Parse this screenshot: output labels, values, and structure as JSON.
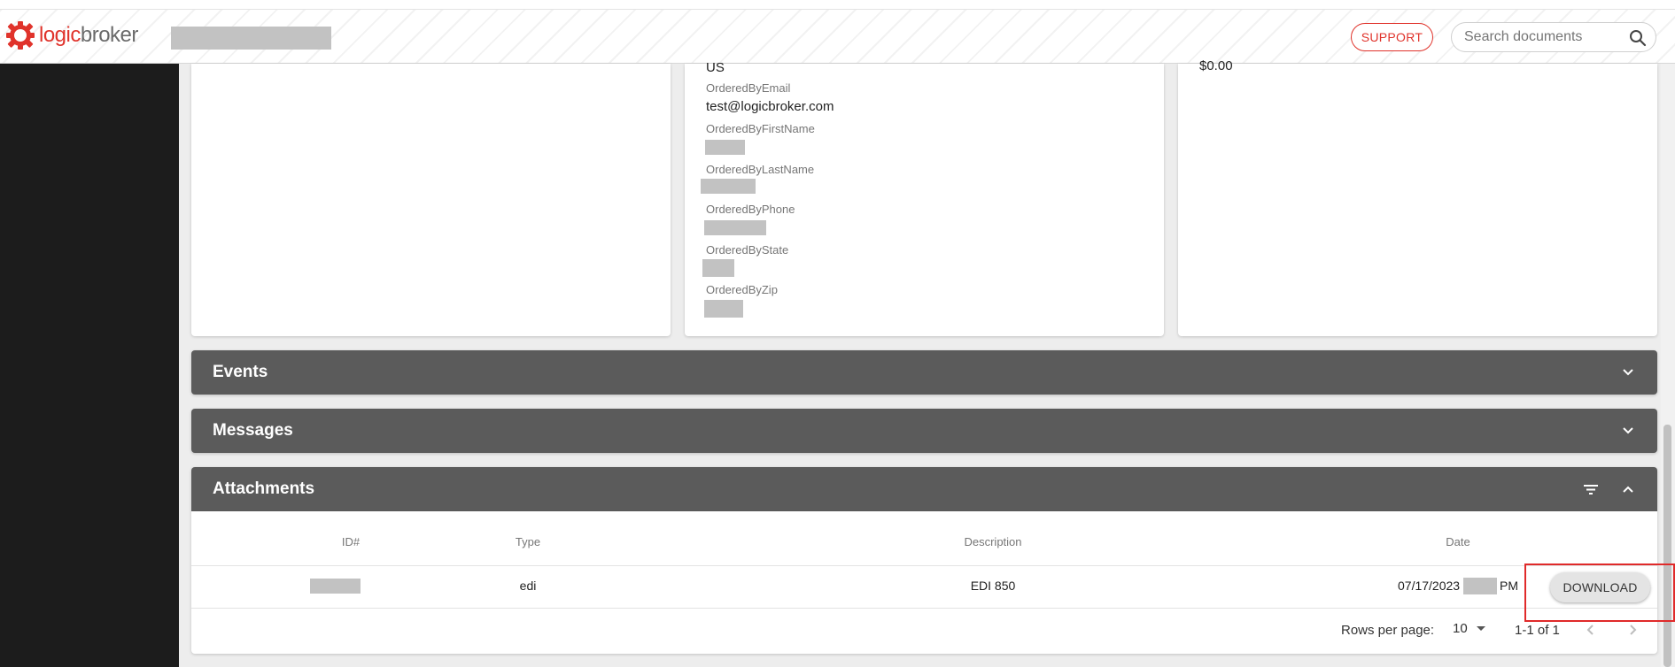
{
  "header": {
    "logo_part1": "logic",
    "logo_part2": "broker",
    "support_label": "SUPPORT",
    "search_placeholder": "Search documents"
  },
  "card_b": {
    "country": "US",
    "ordered_by_email_label": "OrderedByEmail",
    "ordered_by_email_value": "test@logicbroker.com",
    "ordered_by_first_name_label": "OrderedByFirstName",
    "ordered_by_last_name_label": "OrderedByLastName",
    "ordered_by_phone_label": "OrderedByPhone",
    "ordered_by_state_label": "OrderedByState",
    "ordered_by_zip_label": "OrderedByZip"
  },
  "card_c": {
    "amount": "$0.00"
  },
  "events": {
    "title": "Events"
  },
  "messages": {
    "title": "Messages"
  },
  "attachments": {
    "title": "Attachments",
    "columns": [
      "ID#",
      "Type",
      "Description",
      "Date"
    ],
    "rows": [
      {
        "type": "edi",
        "description": "EDI 850",
        "date": "07/17/2023",
        "time_suffix": "PM",
        "action": "DOWNLOAD"
      }
    ],
    "pagination": {
      "rows_per_page_label": "Rows per page:",
      "rows_per_page": "10",
      "range": "1-1 of 1"
    }
  },
  "colors": {
    "brand_red": "#e0332b",
    "accordion_bg": "#5b5b5b",
    "nav_bg": "#1c1c1c",
    "highlight": "#e02a2a"
  }
}
